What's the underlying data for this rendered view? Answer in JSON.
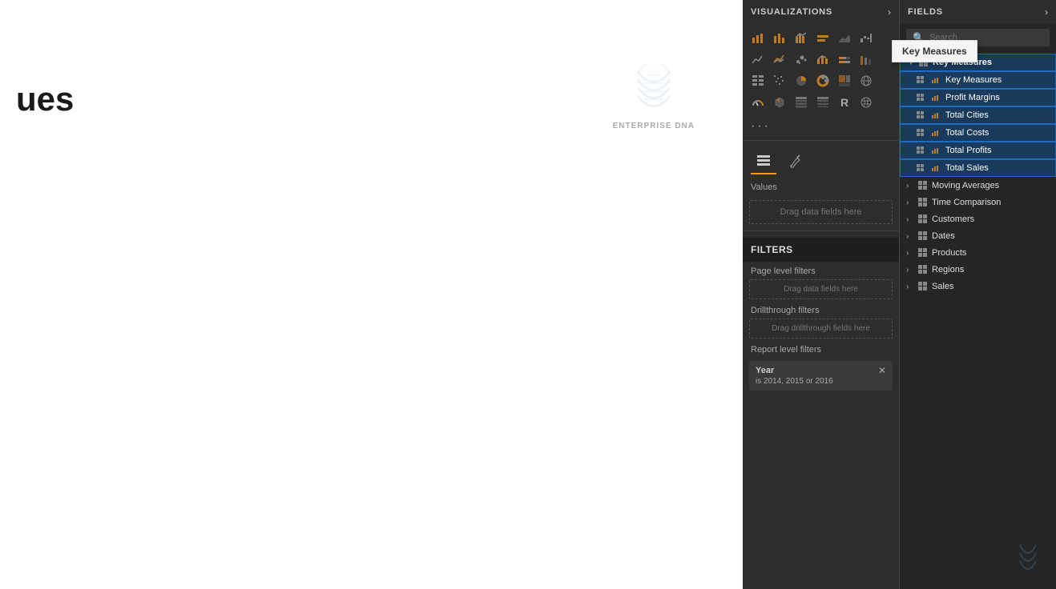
{
  "canvas": {
    "title": "ues",
    "logo_text": "ENTERPRISE DNA"
  },
  "visualizations": {
    "header_title": "VISUALIZATIONS",
    "format_tabs": {
      "values_label": "Values",
      "drag_placeholder": "Drag data fields here"
    }
  },
  "filters": {
    "header": "FILTERS",
    "page_level": "Page level filters",
    "drag_page": "Drag data fields here",
    "drillthrough": "Drillthrough filters",
    "drag_drill": "Drag drillthrough fields here",
    "report_level": "Report level filters",
    "chip": {
      "title": "Year",
      "value": "is 2014, 2015 or 2016"
    }
  },
  "fields": {
    "header_title": "FIELDS",
    "search_placeholder": "Search",
    "tooltip_label": "Key Measures",
    "groups": [
      {
        "name": "Key Measures",
        "expanded": true,
        "items": [
          {
            "name": "Key Measures",
            "is_group_header": true
          },
          {
            "name": "Profit Margins"
          },
          {
            "name": "Total Cities"
          },
          {
            "name": "Total Costs"
          },
          {
            "name": "Total Profits"
          },
          {
            "name": "Total Sales"
          }
        ]
      },
      {
        "name": "Moving Averages",
        "expanded": false
      },
      {
        "name": "Time Comparison",
        "expanded": false
      },
      {
        "name": "Customers",
        "expanded": false
      },
      {
        "name": "Dates",
        "expanded": false
      },
      {
        "name": "Products",
        "expanded": false
      },
      {
        "name": "Regions",
        "expanded": false
      },
      {
        "name": "Sales",
        "expanded": false
      }
    ]
  },
  "icons": {
    "search": "🔍",
    "close": "✕",
    "arrow_right": "›",
    "arrow_down": "∨",
    "more": "..."
  }
}
